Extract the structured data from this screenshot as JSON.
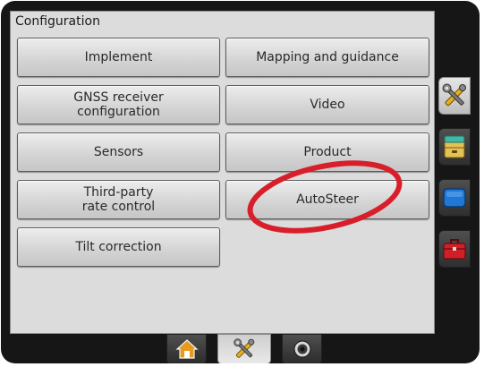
{
  "panel": {
    "title": "Configuration",
    "buttons": [
      {
        "label": "Implement"
      },
      {
        "label": "Mapping and guidance"
      },
      {
        "label": "GNSS receiver\nconfiguration"
      },
      {
        "label": "Video"
      },
      {
        "label": "Sensors"
      },
      {
        "label": "Product"
      },
      {
        "label": "Third-party\nrate control"
      },
      {
        "label": "AutoSteer"
      },
      {
        "label": "Tilt correction"
      }
    ]
  },
  "side_tabs": [
    {
      "icon": "tools-icon",
      "active": true
    },
    {
      "icon": "folder-cabinet-icon",
      "active": false
    },
    {
      "icon": "screen-icon",
      "active": false
    },
    {
      "icon": "toolbox-icon",
      "active": false
    }
  ],
  "bottom_tabs": [
    {
      "icon": "home-icon",
      "active": false
    },
    {
      "icon": "tools-icon",
      "active": true
    },
    {
      "icon": "camera-icon",
      "active": false
    }
  ],
  "colors": {
    "highlight_ellipse": "#d81e2a",
    "tools_icon_yellow": "#e6b020",
    "folder_tan": "#e2c255",
    "screen_blue": "#1f78d6",
    "toolbox_red": "#cf1f27",
    "home_orange": "#e79b1e"
  }
}
